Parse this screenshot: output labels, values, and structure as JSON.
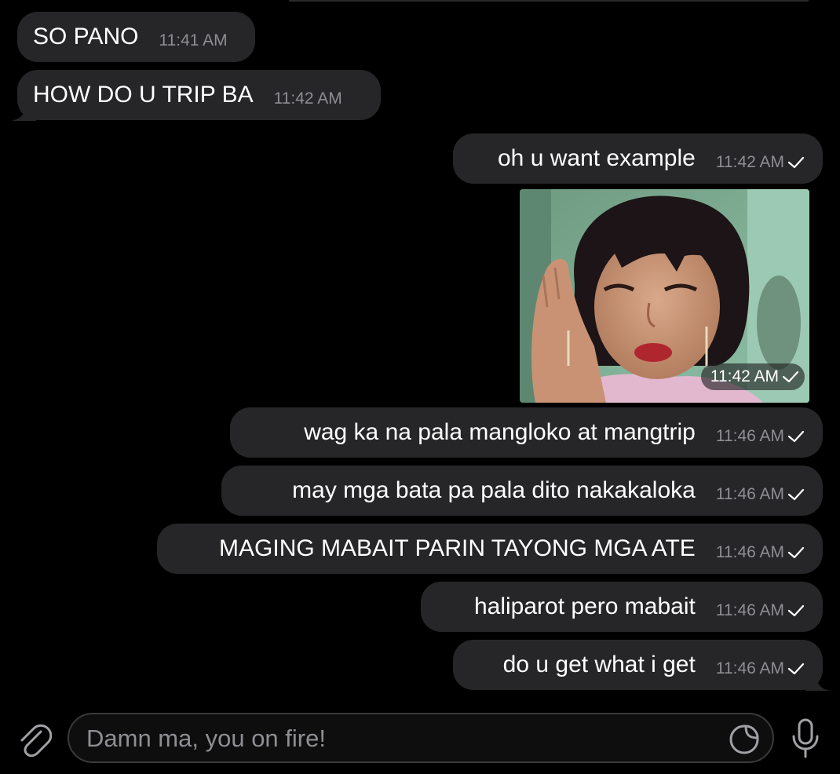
{
  "messages": [
    {
      "side": "in",
      "text": "SO PANO",
      "time": "11:41 AM"
    },
    {
      "side": "in",
      "text": "HOW DO U TRIP BA",
      "time": "11:42 AM"
    },
    {
      "side": "out",
      "text": "oh u want example",
      "time": "11:42 AM"
    },
    {
      "side": "out",
      "type": "photo",
      "time": "11:42 AM"
    },
    {
      "side": "out",
      "text": "wag ka na pala mangloko at mangtrip",
      "time": "11:46 AM"
    },
    {
      "side": "out",
      "text": "may mga bata pa pala dito nakakaloka",
      "time": "11:46 AM"
    },
    {
      "side": "out",
      "text": "MAGING MABAIT PARIN TAYONG MGA ATE",
      "time": "11:46 AM"
    },
    {
      "side": "out",
      "text": "haliparot pero mabait",
      "time": "11:46 AM"
    },
    {
      "side": "out",
      "text": "do u get what i get",
      "time": "11:46 AM"
    }
  ],
  "composer": {
    "placeholder": "Damn ma, you on fire!",
    "value": ""
  },
  "icons": {
    "attach": "paperclip-icon",
    "sticker": "sticker-icon",
    "mic": "microphone-icon",
    "read": "checkmark-icon"
  },
  "colors": {
    "background": "#000000",
    "bubble": "#262628",
    "timestamp": "#8e8e93",
    "icon": "#a1a1a6"
  }
}
